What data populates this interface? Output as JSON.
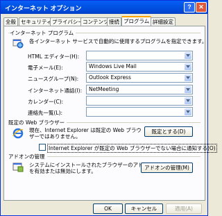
{
  "window": {
    "title": "インターネット オプション",
    "help_glyph": "?",
    "close_glyph": "✕"
  },
  "tabs": [
    "全般",
    "セキュリティ",
    "プライバシー",
    "コンテンツ",
    "接続",
    "プログラム",
    "詳細設定"
  ],
  "programs": {
    "heading": "インターネット プログラム",
    "description": "各インターネット サービスで自動的に使用するプログラムを指定できます。",
    "rows": [
      {
        "label": "HTML エディター(H):",
        "value": ""
      },
      {
        "label": "電子メール(E):",
        "value": "Windows Live Mail"
      },
      {
        "label": "ニュースグループ(N):",
        "value": "Outlook Express"
      },
      {
        "label": "インターネット通話(I):",
        "value": "NetMeeting"
      },
      {
        "label": "カレンダー(C):",
        "value": ""
      },
      {
        "label": "連絡先一覧(L):",
        "value": ""
      }
    ]
  },
  "default_browser": {
    "heading": "既定の Web ブラウザー",
    "line1": "現在、Internet Explorer は既定の Web ブラウ",
    "line2": "ザーではありません。",
    "button": "既定とする(D)",
    "checkbox_label": "Internet Explorer が既定の Web ブラウザーでない場合に通知する(O)"
  },
  "addons": {
    "heading": "アドオンの管理",
    "line1": "システムにインストールされたブラウザーのアドオン",
    "line2": "を有効または無効にします。",
    "button": "アドオンの管理(M)"
  },
  "footer": {
    "ok": "OK",
    "cancel": "キャンセル",
    "apply": "適用(A)"
  },
  "colors": {
    "title_blue": "#0054e3",
    "tab_highlight": "#f9a400",
    "face": "#ece9d8"
  }
}
